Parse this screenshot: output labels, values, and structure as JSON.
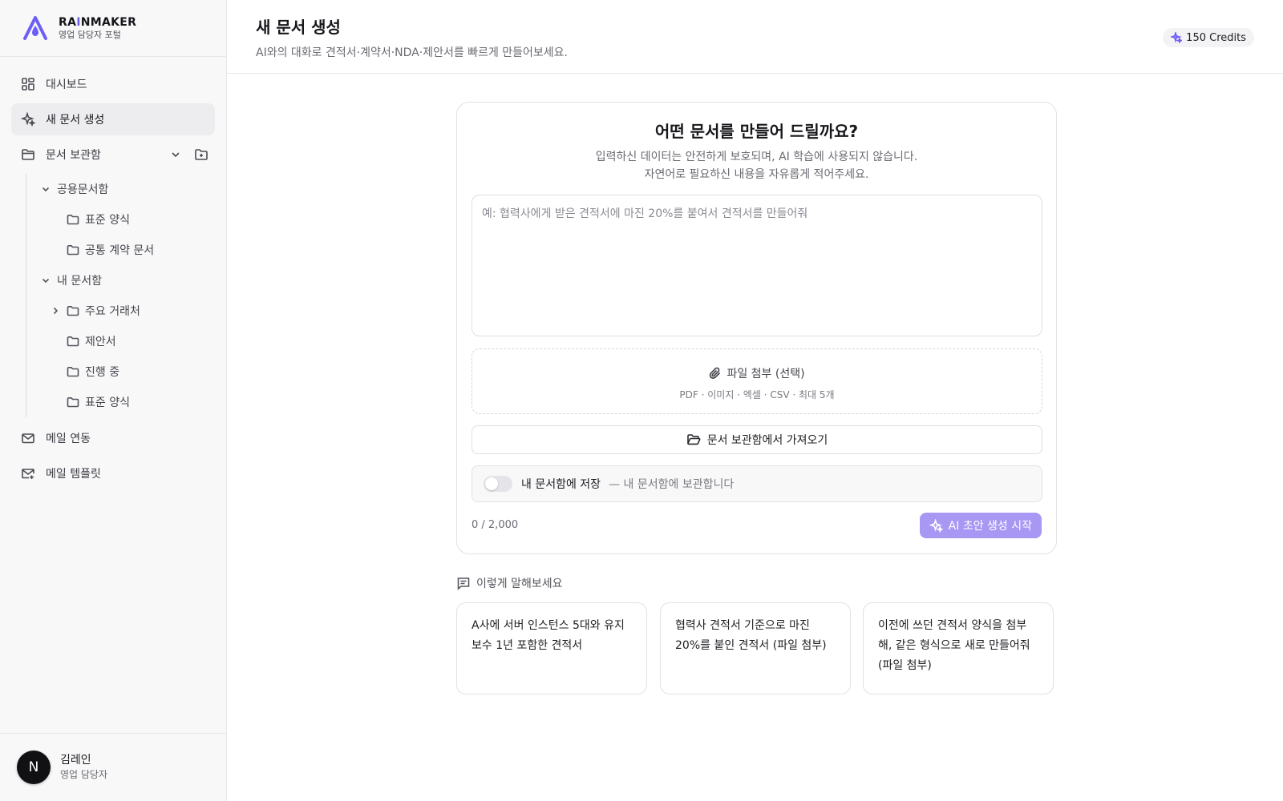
{
  "brand": {
    "name_prefix": "RA",
    "name_accent": "I",
    "name_suffix": "NMAKER",
    "subtitle": "영업 담당자 포털"
  },
  "sidebar": {
    "items": [
      {
        "label": "대시보드",
        "icon": "dashboard-icon"
      },
      {
        "label": "새 문서 생성",
        "icon": "sparkle-icon",
        "active": true
      },
      {
        "label": "문서 보관함",
        "icon": "folder-icon"
      },
      {
        "label": "메일 연동",
        "icon": "mail-icon"
      },
      {
        "label": "메일 템플릿",
        "icon": "mail-template-icon"
      }
    ],
    "tree": {
      "shared": {
        "label": "공용문서함",
        "children": [
          "표준 양식",
          "공통 계약 문서"
        ]
      },
      "mine": {
        "label": "내 문서함",
        "children": [
          "주요 거래처",
          "제안서",
          "진행 중",
          "표준 양식"
        ]
      }
    }
  },
  "user": {
    "initial": "N",
    "name": "김레인",
    "role": "영업 담당자"
  },
  "header": {
    "title": "새 문서 생성",
    "subtitle": "AI와의 대화로 견적서·계약서·NDA·제안서를 빠르게 만들어보세요.",
    "credits": "150 Credits"
  },
  "composer": {
    "title": "어떤 문서를 만들어 드릴까요?",
    "desc_line1": "입력하신 데이터는 안전하게 보호되며, AI 학습에 사용되지 않습니다.",
    "desc_line2": "자연어로 필요하신 내용을 자유롭게 적어주세요.",
    "placeholder": "예: 협력사에게 받은 견적서에 마진 20%를 붙여서 견적서를 만들어줘",
    "value": "",
    "attach_label": "파일 첨부 (선택)",
    "attach_hint": "PDF · 이미지 · 엑셀 · CSV · 최대 5개",
    "import_label": "문서 보관함에서 가져오기",
    "save_label": "내 문서함에 저장",
    "save_hint": "— 내 문서함에 보관합니다",
    "save_enabled": false,
    "counter": "0 / 2,000",
    "generate_label": "AI 초안 생성 시작"
  },
  "examples": {
    "heading": "이렇게 말해보세요",
    "items": [
      "A사에 서버 인스턴스 5대와 유지보수 1년 포함한 견적서",
      "협력사 견적서 기준으로 마진 20%를 붙인 견적서 (파일 첨부)",
      "이전에 쓰던 견적서 양식을 첨부해, 같은 형식으로 새로 만들어줘 (파일 첨부)"
    ]
  },
  "colors": {
    "accent": "#6d5ef5",
    "button_disabled": "#a898f4",
    "avatar_bg": "#111114"
  }
}
